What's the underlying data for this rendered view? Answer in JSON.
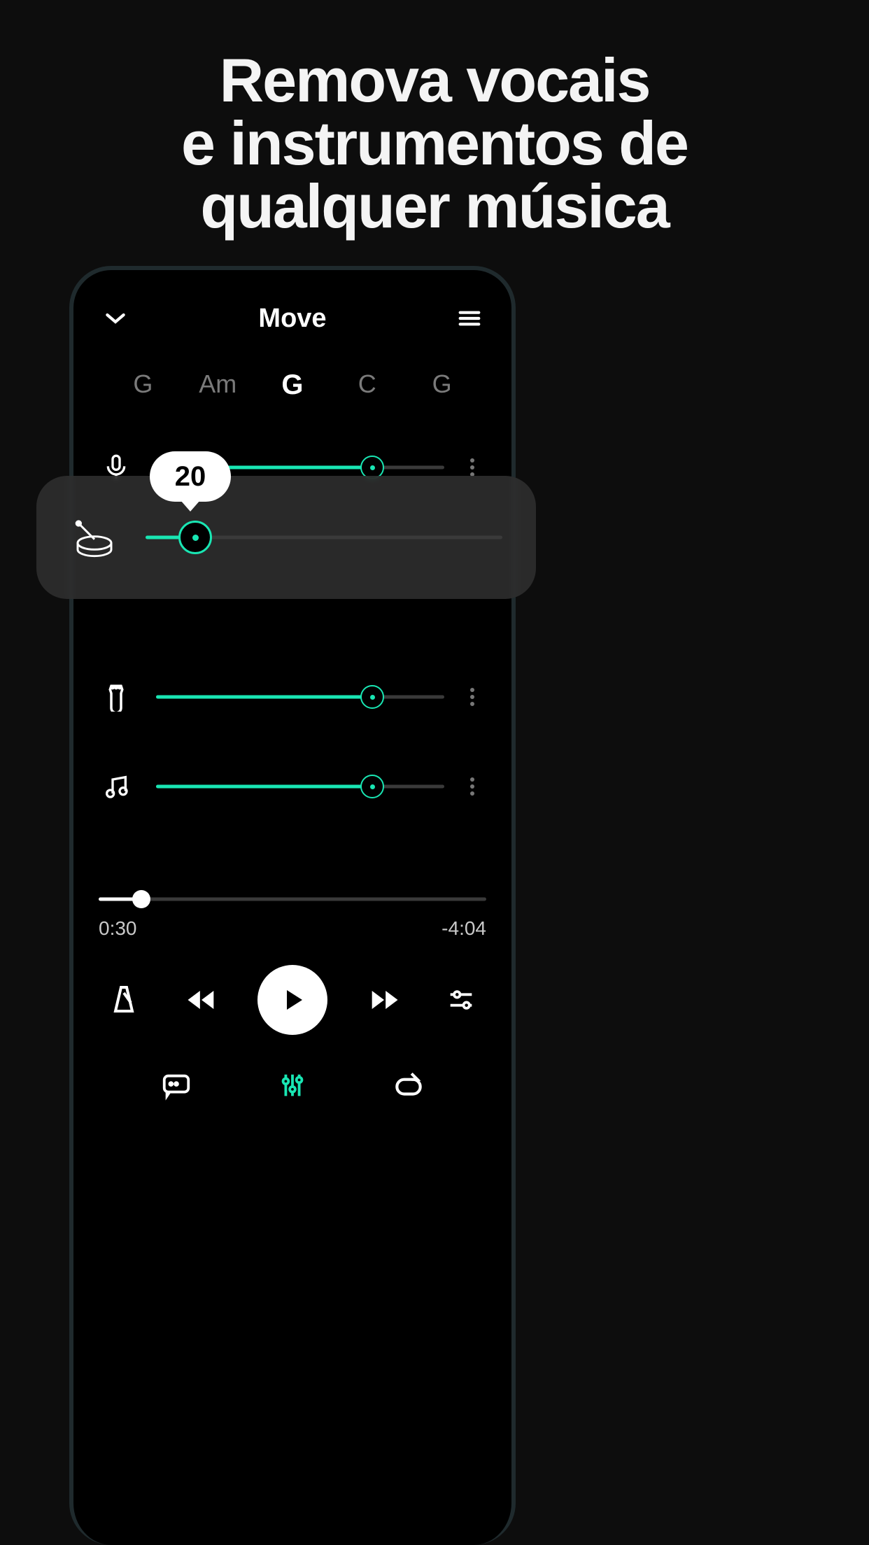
{
  "hero": {
    "line1": "Remova vocais",
    "line2": "e instrumentos de",
    "line3": "qualquer música"
  },
  "header": {
    "title": "Move"
  },
  "chords": [
    {
      "label": "G",
      "active": false
    },
    {
      "label": "Am",
      "active": false
    },
    {
      "label": "G",
      "active": true
    },
    {
      "label": "C",
      "active": false
    },
    {
      "label": "G",
      "active": false
    }
  ],
  "tracks": {
    "vocals": {
      "value": 75,
      "icon": "mic-icon"
    },
    "drums": {
      "value": 20,
      "icon": "drum-icon",
      "tooltip": "20"
    },
    "guitar": {
      "value": 75,
      "icon": "guitar-icon"
    },
    "other": {
      "value": 75,
      "icon": "music-note-icon"
    }
  },
  "progress": {
    "value_pct": 11,
    "elapsed": "0:30",
    "remaining": "-4:04"
  },
  "colors": {
    "accent": "#19e6b3",
    "bg": "#0d0d0d"
  }
}
